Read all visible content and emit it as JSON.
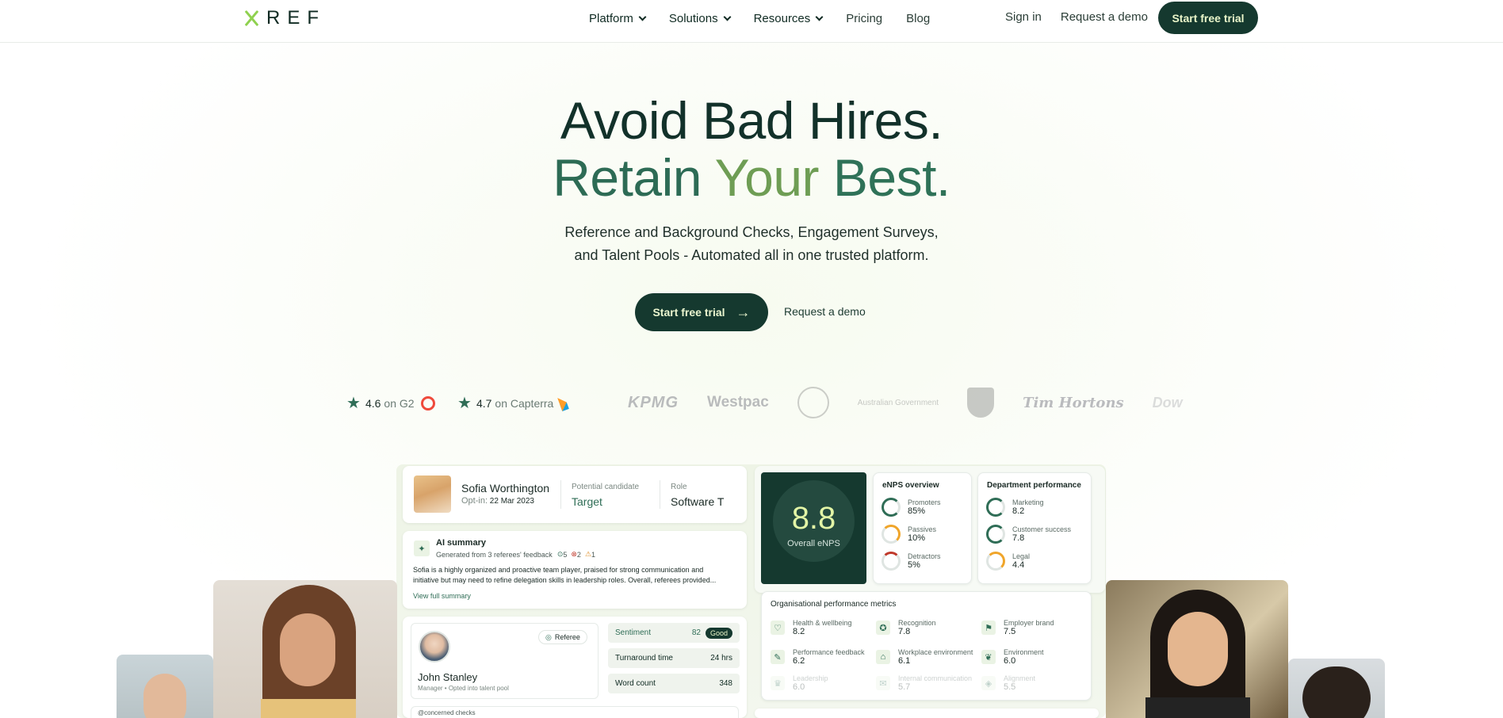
{
  "nav": {
    "logo_text": "REF",
    "items": [
      {
        "label": "Platform",
        "dropdown": true
      },
      {
        "label": "Solutions",
        "dropdown": true
      },
      {
        "label": "Resources",
        "dropdown": true
      },
      {
        "label": "Pricing",
        "dropdown": false
      },
      {
        "label": "Blog",
        "dropdown": false
      }
    ],
    "sign_in": "Sign in",
    "request_demo": "Request a demo",
    "start_trial": "Start free trial"
  },
  "hero": {
    "line1": "Avoid Bad Hires.",
    "line2_a": "Retain ",
    "line2_b": "Your ",
    "line2_c": "Best.",
    "sub1": "Reference and Background Checks, Engagement Surveys,",
    "sub2": "and Talent Pools - Automated all in one trusted platform.",
    "cta_primary": "Start free trial",
    "cta_secondary": "Request a demo"
  },
  "ratings": {
    "g2_score": "4.6",
    "g2_label": "on G2",
    "capterra_score": "4.7",
    "capterra_label": "on Capterra"
  },
  "logos": [
    "KPMG",
    "Westpac",
    "Australian Government",
    "Tim Hortons",
    "Dow"
  ],
  "candidate": {
    "name": "Sofia Worthington",
    "optin_label": "Opt-in:",
    "optin_date": "22 Mar 2023",
    "potential_label": "Potential candidate",
    "potential_value": "Target",
    "role_label": "Role",
    "role_value": "Software T"
  },
  "ai_summary": {
    "title": "AI summary",
    "meta": "Generated from 3 referees' feedback",
    "count_good": "5",
    "count_bad": "2",
    "count_warn": "1",
    "text1": "Sofia is a highly organized and proactive team player, praised for strong communication and",
    "text2": "initiative but may need to refine delegation skills in leadership roles. Overall, referees provided...",
    "link": "View full summary"
  },
  "referee": {
    "badge": "Referee",
    "name": "John Stanley",
    "meta": "Manager • Opted into talent pool",
    "stats": [
      {
        "label": "Sentiment",
        "value": "82",
        "pill": "Good"
      },
      {
        "label": "Turnaround time",
        "value": "24 hrs"
      },
      {
        "label": "Word count",
        "value": "348"
      }
    ],
    "bottom_text": "@concerned checks"
  },
  "enps": {
    "value": "8.8",
    "label": "Overall eNPS",
    "overview_title": "eNPS overview",
    "items": [
      {
        "label": "Promoters",
        "value": "85%",
        "color": "#2f6d56"
      },
      {
        "label": "Passives",
        "value": "10%",
        "color": "#f0a52a"
      },
      {
        "label": "Detractors",
        "value": "5%",
        "color": "#c0392b"
      }
    ]
  },
  "department": {
    "title": "Department performance",
    "items": [
      {
        "label": "Marketing",
        "value": "8.2",
        "color": "#2f6d56"
      },
      {
        "label": "Customer success",
        "value": "7.8",
        "color": "#2f6d56"
      },
      {
        "label": "Legal",
        "value": "4.4",
        "color": "#f0a52a"
      }
    ]
  },
  "org_metrics": {
    "title": "Organisational performance metrics",
    "items": [
      {
        "label": "Health & wellbeing",
        "value": "8.2"
      },
      {
        "label": "Recognition",
        "value": "7.8"
      },
      {
        "label": "Employer brand",
        "value": "7.5"
      },
      {
        "label": "Performance feedback",
        "value": "6.2"
      },
      {
        "label": "Workplace environment",
        "value": "6.1"
      },
      {
        "label": "Environment",
        "value": "6.0"
      },
      {
        "label": "Leadership",
        "value": "6.0"
      },
      {
        "label": "Internal communication",
        "value": "5.7"
      },
      {
        "label": "Alignment",
        "value": "5.5"
      }
    ]
  }
}
